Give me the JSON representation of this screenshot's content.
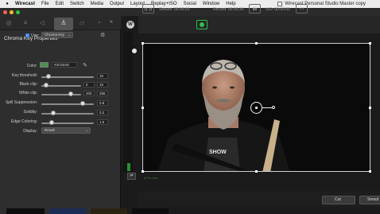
{
  "menubar": {
    "app_name": "Wirecast",
    "items": [
      "File",
      "Edit",
      "Switch",
      "Media",
      "Output",
      "Layout",
      "Replay+ISO",
      "Social",
      "Window",
      "Help"
    ],
    "window_title": "Wirecast Personal Studio Master copy"
  },
  "panel": {
    "title": "Chroma Key Properties",
    "use_label": "Use:",
    "use_checked": true,
    "use_value": "Chroma Key",
    "color_label": "Color:",
    "color_value": "#4C924D",
    "key_threshold_label": "Key threshold:",
    "key_threshold_value": "10",
    "black_clip_label": "Black clip:",
    "black_clip_low": "0",
    "black_clip_high": "15",
    "white_clip_label": "White clip:",
    "white_clip_low": "200",
    "white_clip_high": "255",
    "spill_label": "Spill Suppression:",
    "spill_value": "0.8",
    "solidity_label": "Solidity:",
    "solidity_value": "0.2",
    "edge_label": "Edge Coloring:",
    "edge_value": "1.5",
    "display_label": "Display:",
    "display_value": "Result"
  },
  "status": {
    "stream_label": "Stream: 00:00:00",
    "record_label": "Record: 00:00:35",
    "iso_label": "ISO: 00:00:00"
  },
  "preview_status": "● Preview",
  "transitions": {
    "cut_label": "Cut",
    "smooth_label": "Smoot"
  },
  "colors": {
    "accent_blue": "#3d86e8",
    "record_green": "#2fbf4f",
    "chroma_color": "#4C924D"
  }
}
